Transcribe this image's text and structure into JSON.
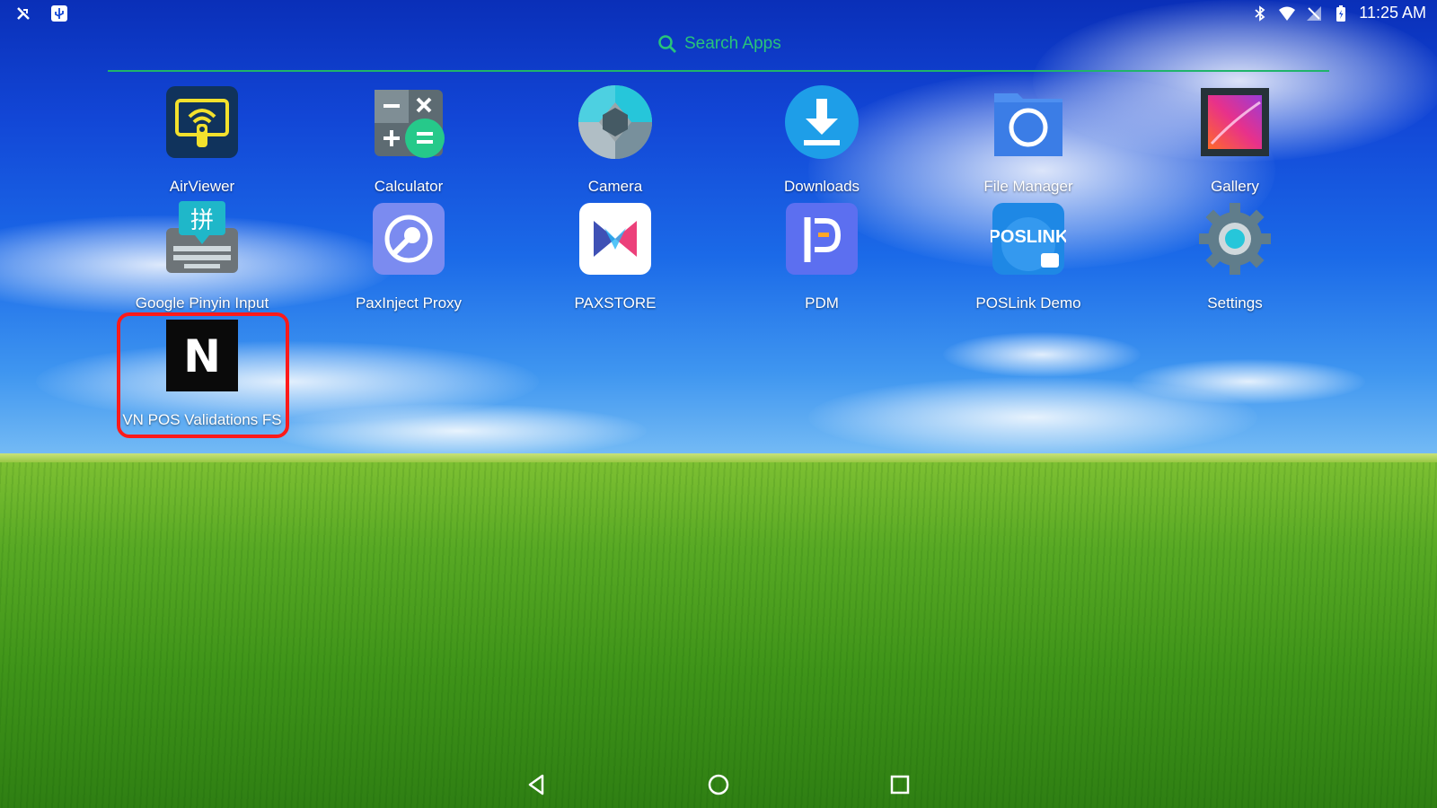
{
  "status_bar": {
    "time": "11:25 AM",
    "left_icons": [
      "no-sim-icon",
      "usb-icon"
    ],
    "right_icons": [
      "bluetooth-icon",
      "wifi-icon",
      "signal-icon",
      "battery-icon"
    ]
  },
  "search": {
    "placeholder": "Search Apps",
    "accent": "#28c47a"
  },
  "apps": [
    {
      "name": "AirViewer",
      "icon": "airviewer-icon"
    },
    {
      "name": "Calculator",
      "icon": "calculator-icon"
    },
    {
      "name": "Camera",
      "icon": "camera-icon"
    },
    {
      "name": "Downloads",
      "icon": "downloads-icon"
    },
    {
      "name": "File Manager",
      "icon": "file-manager-icon"
    },
    {
      "name": "Gallery",
      "icon": "gallery-icon"
    },
    {
      "name": "Google Pinyin Input",
      "icon": "pinyin-keyboard-icon"
    },
    {
      "name": "PaxInject Proxy",
      "icon": "paxinject-icon"
    },
    {
      "name": "PAXSTORE",
      "icon": "paxstore-icon"
    },
    {
      "name": "PDM",
      "icon": "pdm-icon"
    },
    {
      "name": "POSLink Demo",
      "icon": "poslink-icon"
    },
    {
      "name": "Settings",
      "icon": "settings-gear-icon"
    },
    {
      "name": "VN POS Validations FS",
      "icon": "vn-pos-icon"
    }
  ],
  "icon_text": {
    "pinyin": "拼",
    "poslink": "POSLINK",
    "vn": "N"
  },
  "highlight_color": "#ff1a1a",
  "nav": [
    "back-icon",
    "home-icon",
    "recents-icon"
  ]
}
